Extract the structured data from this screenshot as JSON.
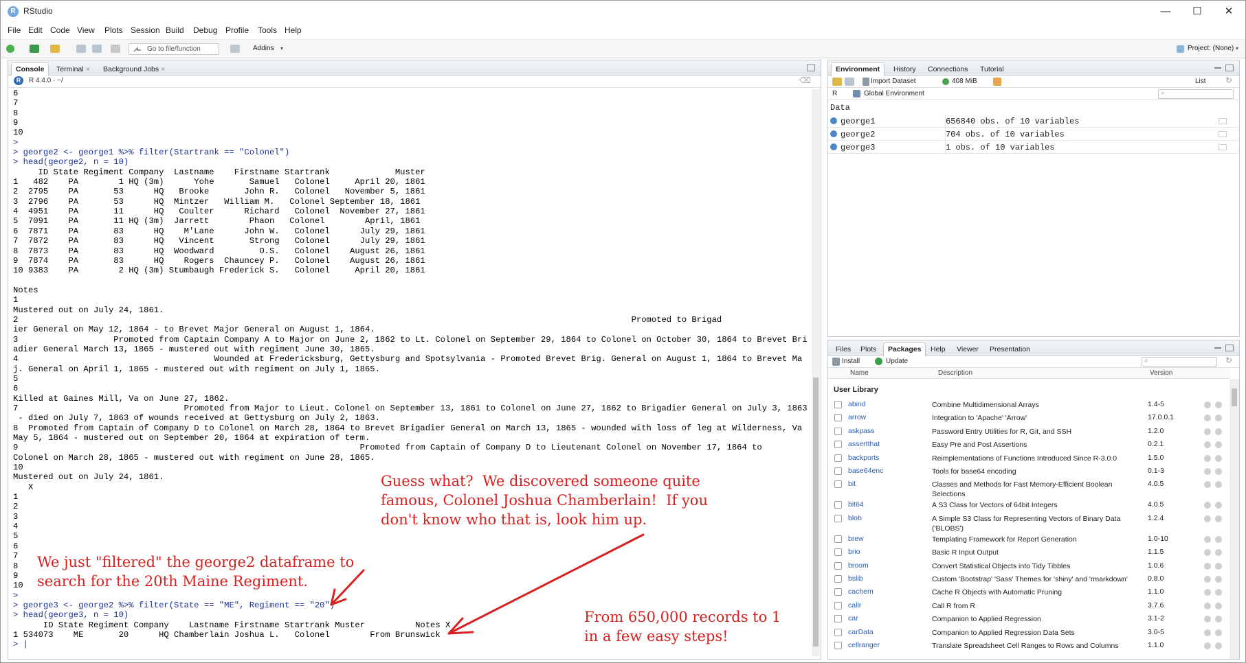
{
  "window": {
    "title": "RStudio",
    "minimize": "—",
    "maximize": "☐",
    "close": "✕"
  },
  "menu": [
    "File",
    "Edit",
    "Code",
    "View",
    "Plots",
    "Session",
    "Build",
    "Debug",
    "Profile",
    "Tools",
    "Help"
  ],
  "toolbar": {
    "goto_placeholder": "Go to file/function",
    "addins": "Addins",
    "project": "Project: (None)"
  },
  "console_pane": {
    "tabs": [
      "Console",
      "Terminal",
      "Background Jobs"
    ],
    "r_version": "R 4.4.0 · ~/",
    "lines": [
      "6",
      "7",
      "8",
      "9",
      "10",
      ">",
      "> george2 <- george1 %>% filter(Startrank == \"Colonel\")",
      "> head(george2, n = 10)",
      "     ID State Regiment Company  Lastname    Firstname Startrank             Muster",
      "1   482    PA        1 HQ (3m)      Yohe       Samuel   Colonel     April 20, 1861",
      "2  2795    PA       53      HQ   Brooke       John R.   Colonel   November 5, 1861",
      "3  2796    PA       53      HQ  Mintzer   William M.   Colonel September 18, 1861",
      "4  4951    PA       11      HQ   Coulter      Richard   Colonel  November 27, 1861",
      "5  7091    PA       11 HQ (3m)  Jarrett        Phaon   Colonel        April, 1861",
      "6  7871    PA       83      HQ    M'Lane      John W.   Colonel      July 29, 1861",
      "7  7872    PA       83      HQ   Vincent       Strong   Colonel      July 29, 1861",
      "8  7873    PA       83      HQ  Woodward         O.S.   Colonel    August 26, 1861",
      "9  7874    PA       83      HQ    Rogers  Chauncey P.   Colonel    August 26, 1861",
      "10 9383    PA        2 HQ (3m) Stumbaugh Frederick S.   Colonel     April 20, 1861",
      "",
      "Notes",
      "1",
      "Mustered out on July 24, 1861.",
      "2                                                                                                                          Promoted to Brigad",
      "ier General on May 12, 1864 - to Brevet Major General on August 1, 1864.",
      "3                   Promoted from Captain Company A to Major on June 2, 1862 to Lt. Colonel on September 29, 1864 to Colonel on October 30, 1864 to Brevet Brig",
      "adier General March 13, 1865 - mustered out with regiment June 30, 1865.",
      "4                                       Wounded at Fredericksburg, Gettysburg and Spotsylvania - Promoted Brevet Brig. General on August 1, 1864 to Brevet Ma",
      "j. General on April 1, 1865 - mustered out with regiment on July 1, 1865.",
      "5",
      "6",
      "Killed at Gaines Mill, Va on June 27, 1862.",
      "7                                 Promoted from Major to Lieut. Colonel on September 13, 1861 to Colonel on June 27, 1862 to Brigadier General on July 3, 1863",
      " - died on July 7, 1863 of wounds received at Gettysburg on July 2, 1863.",
      "8  Promoted from Captain of Company D to Colonel on March 28, 1864 to Brevet Brigadier General on March 13, 1865 - wounded with loss of leg at Wilderness, Va on",
      "May 5, 1864 - mustered out on September 20, 1864 at expiration of term.",
      "9                                                                    Promoted from Captain of Company D to Lieutenant Colonel on November 17, 1864 to",
      "Colonel on March 28, 1865 - mustered out with regiment on June 28, 1865.",
      "10",
      "Mustered out on July 24, 1861.",
      "   X",
      "1",
      "2",
      "3",
      "4",
      "5",
      "6",
      "7",
      "8",
      "9",
      "10",
      ">",
      "> george3 <- george2 %>% filter(State == \"ME\", Regiment == \"20\")",
      "> head(george3, n = 10)",
      "      ID State Regiment Company    Lastname Firstname Startrank Muster          Notes X",
      "1 534073    ME       20      HQ Chamberlain Joshua L.   Colonel        From Brunswick",
      "> |"
    ],
    "annotations": {
      "guess": "Guess what?  We discovered someone quite\nfamous, Colonel Joshua Chamberlain!  If you\ndon't know who that is, look him up.",
      "filtered": "We just \"filtered\" the george2 dataframe to\nsearch for the 20th Maine Regiment.",
      "records": "From 650,000 records to 1\nin a few easy steps!"
    }
  },
  "env_pane": {
    "tabs": [
      "Environment",
      "History",
      "Connections",
      "Tutorial"
    ],
    "import_dataset": "Import Dataset",
    "memory": "408 MiB",
    "list_view": "List",
    "lang": "R",
    "scope": "Global Environment",
    "section": "Data",
    "rows": [
      {
        "name": "george1",
        "value": "656840 obs. of 10 variables"
      },
      {
        "name": "george2",
        "value": "704 obs. of 10 variables"
      },
      {
        "name": "george3",
        "value": "1 obs. of 10 variables"
      }
    ]
  },
  "files_pane": {
    "tabs": [
      "Files",
      "Plots",
      "Packages",
      "Help",
      "Viewer",
      "Presentation"
    ],
    "install": "Install",
    "update": "Update",
    "columns": {
      "name": "Name",
      "description": "Description",
      "version": "Version"
    },
    "section": "User Library",
    "packages": [
      {
        "name": "abind",
        "desc": "Combine Multidimensional Arrays",
        "ver": "1.4-5"
      },
      {
        "name": "arrow",
        "desc": "Integration to 'Apache' 'Arrow'",
        "ver": "17.0.0.1"
      },
      {
        "name": "askpass",
        "desc": "Password Entry Utilities for R, Git, and SSH",
        "ver": "1.2.0"
      },
      {
        "name": "assertthat",
        "desc": "Easy Pre and Post Assertions",
        "ver": "0.2.1"
      },
      {
        "name": "backports",
        "desc": "Reimplementations of Functions Introduced Since R-3.0.0",
        "ver": "1.5.0"
      },
      {
        "name": "base64enc",
        "desc": "Tools for base64 encoding",
        "ver": "0.1-3"
      },
      {
        "name": "bit",
        "desc": "Classes and Methods for Fast Memory-Efficient Boolean Selections",
        "ver": "4.0.5"
      },
      {
        "name": "bit64",
        "desc": "A S3 Class for Vectors of 64bit Integers",
        "ver": "4.0.5"
      },
      {
        "name": "blob",
        "desc": "A Simple S3 Class for Representing Vectors of Binary Data ('BLOBS')",
        "ver": "1.2.4"
      },
      {
        "name": "brew",
        "desc": "Templating Framework for Report Generation",
        "ver": "1.0-10"
      },
      {
        "name": "brio",
        "desc": "Basic R Input Output",
        "ver": "1.1.5"
      },
      {
        "name": "broom",
        "desc": "Convert Statistical Objects into Tidy Tibbles",
        "ver": "1.0.6"
      },
      {
        "name": "bslib",
        "desc": "Custom 'Bootstrap' 'Sass' Themes for 'shiny' and 'rmarkdown'",
        "ver": "0.8.0"
      },
      {
        "name": "cachem",
        "desc": "Cache R Objects with Automatic Pruning",
        "ver": "1.1.0"
      },
      {
        "name": "callr",
        "desc": "Call R from R",
        "ver": "3.7.6"
      },
      {
        "name": "car",
        "desc": "Companion to Applied Regression",
        "ver": "3.1-2"
      },
      {
        "name": "carData",
        "desc": "Companion to Applied Regression Data Sets",
        "ver": "3.0-5"
      },
      {
        "name": "cellranger",
        "desc": "Translate Spreadsheet Cell Ranges to Rows and Columns",
        "ver": "1.1.0"
      }
    ]
  }
}
